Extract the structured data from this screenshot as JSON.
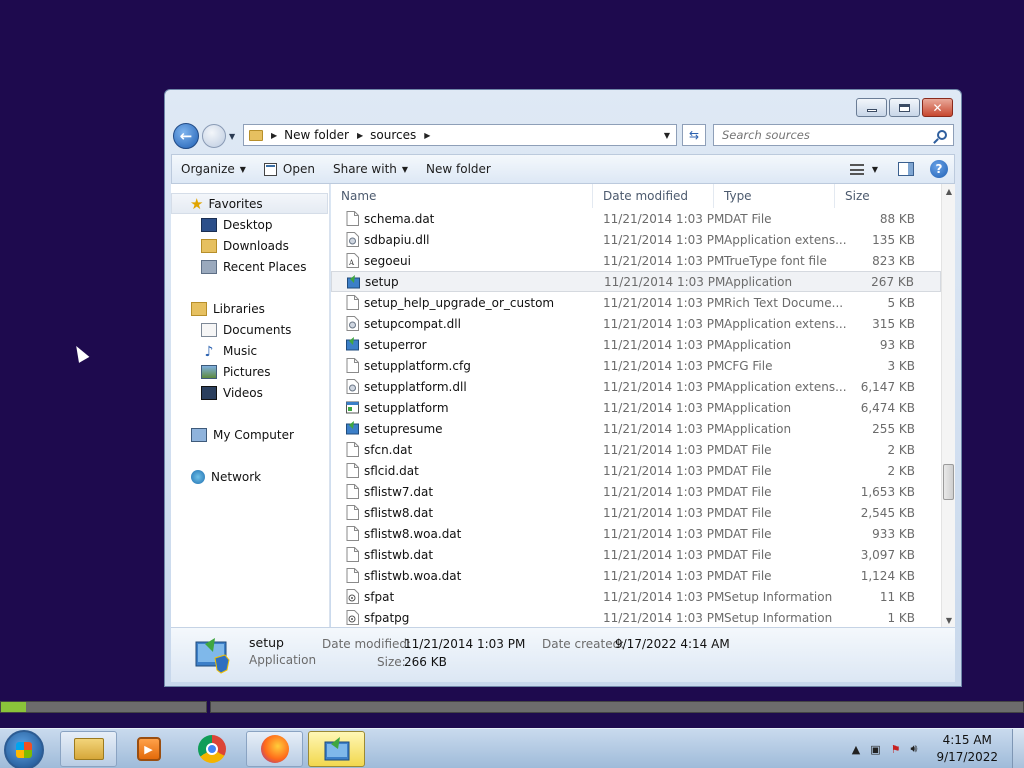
{
  "window": {
    "close_symbol": "✕"
  },
  "address_bar": {
    "crumbs": [
      "New folder",
      "sources"
    ]
  },
  "search": {
    "placeholder": "Search sources"
  },
  "toolbar": {
    "organize": "Organize",
    "open": "Open",
    "share_with": "Share with",
    "new_folder": "New folder",
    "help": "?"
  },
  "nav_pane": {
    "favorites_label": "Favorites",
    "favorites": [
      "Desktop",
      "Downloads",
      "Recent Places"
    ],
    "libraries_label": "Libraries",
    "libraries": [
      "Documents",
      "Music",
      "Pictures",
      "Videos"
    ],
    "computer": "My Computer",
    "network": "Network"
  },
  "columns": {
    "name": "Name",
    "date": "Date modified",
    "type": "Type",
    "size": "Size"
  },
  "files": [
    {
      "name": "schema.dat",
      "date": "11/21/2014 1:03 PM",
      "type": "DAT File",
      "size": "88 KB",
      "icon": "file-icon"
    },
    {
      "name": "sdbapiu.dll",
      "date": "11/21/2014 1:03 PM",
      "type": "Application extens...",
      "size": "135 KB",
      "icon": "dll-icon"
    },
    {
      "name": "segoeui",
      "date": "11/21/2014 1:03 PM",
      "type": "TrueType font file",
      "size": "823 KB",
      "icon": "font-icon"
    },
    {
      "name": "setup",
      "date": "11/21/2014 1:03 PM",
      "type": "Application",
      "size": "267 KB",
      "icon": "setup-icon",
      "selected": true
    },
    {
      "name": "setup_help_upgrade_or_custom",
      "date": "11/21/2014 1:03 PM",
      "type": "Rich Text Docume...",
      "size": "5 KB",
      "icon": "file-icon"
    },
    {
      "name": "setupcompat.dll",
      "date": "11/21/2014 1:03 PM",
      "type": "Application extens...",
      "size": "315 KB",
      "icon": "dll-icon"
    },
    {
      "name": "setuperror",
      "date": "11/21/2014 1:03 PM",
      "type": "Application",
      "size": "93 KB",
      "icon": "setup-icon"
    },
    {
      "name": "setupplatform.cfg",
      "date": "11/21/2014 1:03 PM",
      "type": "CFG File",
      "size": "3 KB",
      "icon": "file-icon"
    },
    {
      "name": "setupplatform.dll",
      "date": "11/21/2014 1:03 PM",
      "type": "Application extens...",
      "size": "6,147 KB",
      "icon": "dll-icon"
    },
    {
      "name": "setupplatform",
      "date": "11/21/2014 1:03 PM",
      "type": "Application",
      "size": "6,474 KB",
      "icon": "app-icon"
    },
    {
      "name": "setupresume",
      "date": "11/21/2014 1:03 PM",
      "type": "Application",
      "size": "255 KB",
      "icon": "setup-icon"
    },
    {
      "name": "sfcn.dat",
      "date": "11/21/2014 1:03 PM",
      "type": "DAT File",
      "size": "2 KB",
      "icon": "file-icon"
    },
    {
      "name": "sflcid.dat",
      "date": "11/21/2014 1:03 PM",
      "type": "DAT File",
      "size": "2 KB",
      "icon": "file-icon"
    },
    {
      "name": "sflistw7.dat",
      "date": "11/21/2014 1:03 PM",
      "type": "DAT File",
      "size": "1,653 KB",
      "icon": "file-icon"
    },
    {
      "name": "sflistw8.dat",
      "date": "11/21/2014 1:03 PM",
      "type": "DAT File",
      "size": "2,545 KB",
      "icon": "file-icon"
    },
    {
      "name": "sflistw8.woa.dat",
      "date": "11/21/2014 1:03 PM",
      "type": "DAT File",
      "size": "933 KB",
      "icon": "file-icon"
    },
    {
      "name": "sflistwb.dat",
      "date": "11/21/2014 1:03 PM",
      "type": "DAT File",
      "size": "3,097 KB",
      "icon": "file-icon"
    },
    {
      "name": "sflistwb.woa.dat",
      "date": "11/21/2014 1:03 PM",
      "type": "DAT File",
      "size": "1,124 KB",
      "icon": "file-icon"
    },
    {
      "name": "sfpat",
      "date": "11/21/2014 1:03 PM",
      "type": "Setup Information",
      "size": "11 KB",
      "icon": "inf-icon"
    },
    {
      "name": "sfpatpg",
      "date": "11/21/2014 1:03 PM",
      "type": "Setup Information",
      "size": "1 KB",
      "icon": "inf-icon"
    }
  ],
  "details": {
    "name": "setup",
    "type": "Application",
    "modified_label": "Date modified:",
    "modified_value": "11/21/2014 1:03 PM",
    "created_label": "Date created:",
    "created_value": "9/17/2022 4:14 AM",
    "size_label": "Size:",
    "size_value": "266 KB"
  },
  "progress": {
    "fraction": 0.12
  },
  "taskbar": {
    "apps": [
      "file-explorer-icon",
      "media-player-icon",
      "chrome-icon",
      "firefox-icon",
      "setup-icon"
    ],
    "time": "4:15 AM",
    "date": "9/17/2022"
  },
  "colors": {
    "desktop": "#1e0a4e",
    "progress_fill": "#8ac33a"
  }
}
